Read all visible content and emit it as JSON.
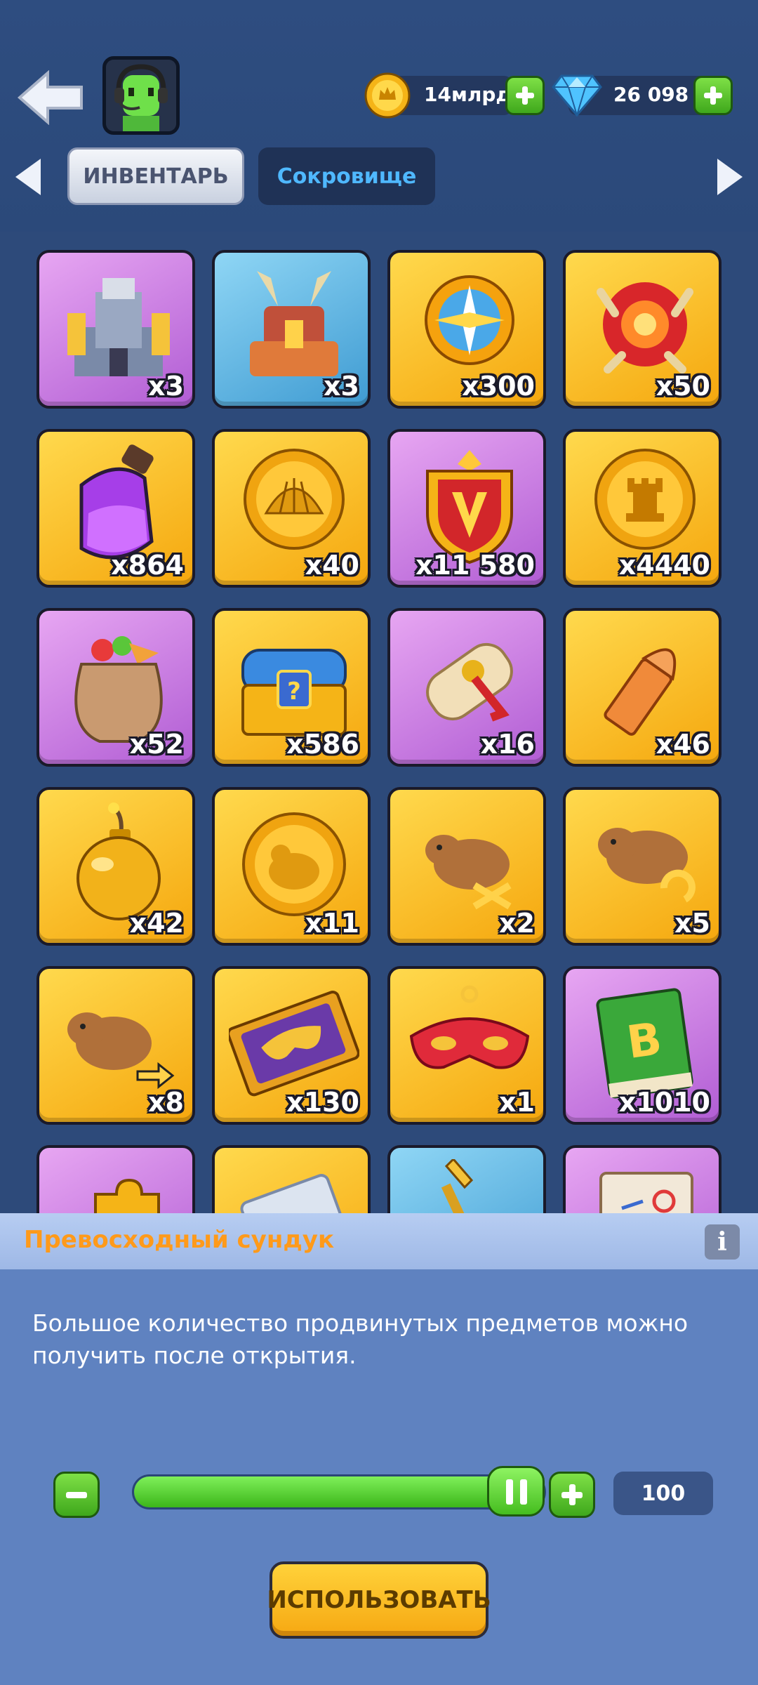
{
  "header": {
    "gold_amount": "14млрд",
    "gem_amount": "26 098"
  },
  "tabs": [
    {
      "label": "ИНВЕНТАРЬ",
      "active": true
    },
    {
      "label": "Сокровище",
      "active": false
    }
  ],
  "items": [
    {
      "name": "castle",
      "count": "x3",
      "bg": "purple"
    },
    {
      "name": "dragon-castle",
      "count": "x3",
      "bg": "blue"
    },
    {
      "name": "compass",
      "count": "x300",
      "bg": "gold"
    },
    {
      "name": "dragon-orb",
      "count": "x50",
      "bg": "gold"
    },
    {
      "name": "purple-potion",
      "count": "x864",
      "bg": "gold"
    },
    {
      "name": "shell-coin",
      "count": "x40",
      "bg": "gold"
    },
    {
      "name": "v-shield",
      "count": "x11 580",
      "bg": "purple"
    },
    {
      "name": "rook-coin",
      "count": "x4440",
      "bg": "gold"
    },
    {
      "name": "food-sack",
      "count": "x52",
      "bg": "purple"
    },
    {
      "name": "mystery-chest",
      "count": "x586",
      "bg": "gold"
    },
    {
      "name": "scroll",
      "count": "x16",
      "bg": "purple"
    },
    {
      "name": "bullet",
      "count": "x46",
      "bg": "gold"
    },
    {
      "name": "bomb",
      "count": "x42",
      "bg": "gold"
    },
    {
      "name": "capybara-coin",
      "count": "x11",
      "bg": "gold"
    },
    {
      "name": "capybara-shuffle",
      "count": "x2",
      "bg": "gold"
    },
    {
      "name": "capybara-refresh",
      "count": "x5",
      "bg": "gold"
    },
    {
      "name": "capybara-transfer",
      "count": "x8",
      "bg": "gold"
    },
    {
      "name": "mask-ticket",
      "count": "x130",
      "bg": "gold"
    },
    {
      "name": "red-mask",
      "count": "x1",
      "bg": "gold"
    },
    {
      "name": "b-book",
      "count": "x1010",
      "bg": "purple"
    },
    {
      "name": "puzzle-piece",
      "count": "",
      "bg": "purple"
    },
    {
      "name": "silver-ticket",
      "count": "",
      "bg": "gold"
    },
    {
      "name": "golden-spear",
      "count": "",
      "bg": "blue"
    },
    {
      "name": "map-board",
      "count": "",
      "bg": "purple"
    }
  ],
  "panel": {
    "title": "Превосходный сундук",
    "info_label": "i",
    "description": "Большое количество продвинутых предметов можно получить после открытия.",
    "quantity": "100",
    "slider_fraction": 1.0,
    "use_label": "ИСПОЛЬЗОВАТЬ"
  }
}
